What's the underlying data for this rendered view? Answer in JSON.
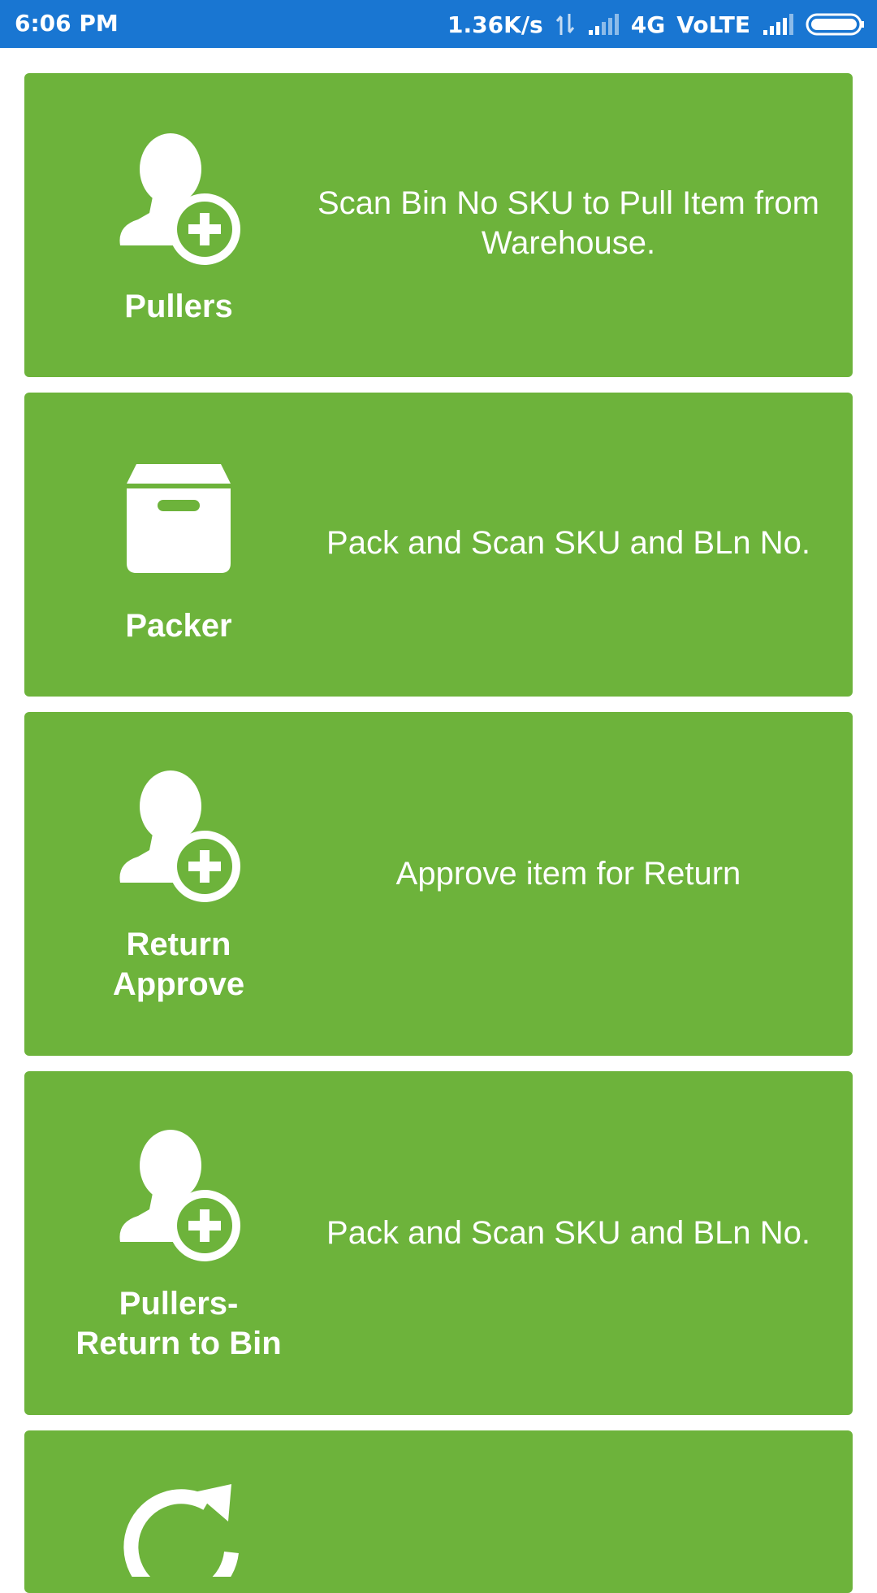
{
  "status_bar": {
    "time": "6:06 PM",
    "speed": "1.36K/s",
    "network": "4G",
    "volte": "VoLTE"
  },
  "cards": [
    {
      "label": "Pullers",
      "description": "Scan Bin No SKU to Pull Item from Warehouse.",
      "icon": "add-user-icon"
    },
    {
      "label": "Packer",
      "description": "Pack and Scan SKU and BLn No.",
      "icon": "box-icon"
    },
    {
      "label": "Return Approve",
      "description": "Approve item for Return",
      "icon": "add-user-icon"
    },
    {
      "label": "Pullers- Return to Bin",
      "description": "Pack and Scan SKU and BLn No.",
      "icon": "add-user-icon"
    },
    {
      "label": "",
      "description": "",
      "icon": "refresh-icon"
    }
  ],
  "colors": {
    "status_bar": "#1976D2",
    "card": "#6db33b",
    "text": "#ffffff"
  }
}
